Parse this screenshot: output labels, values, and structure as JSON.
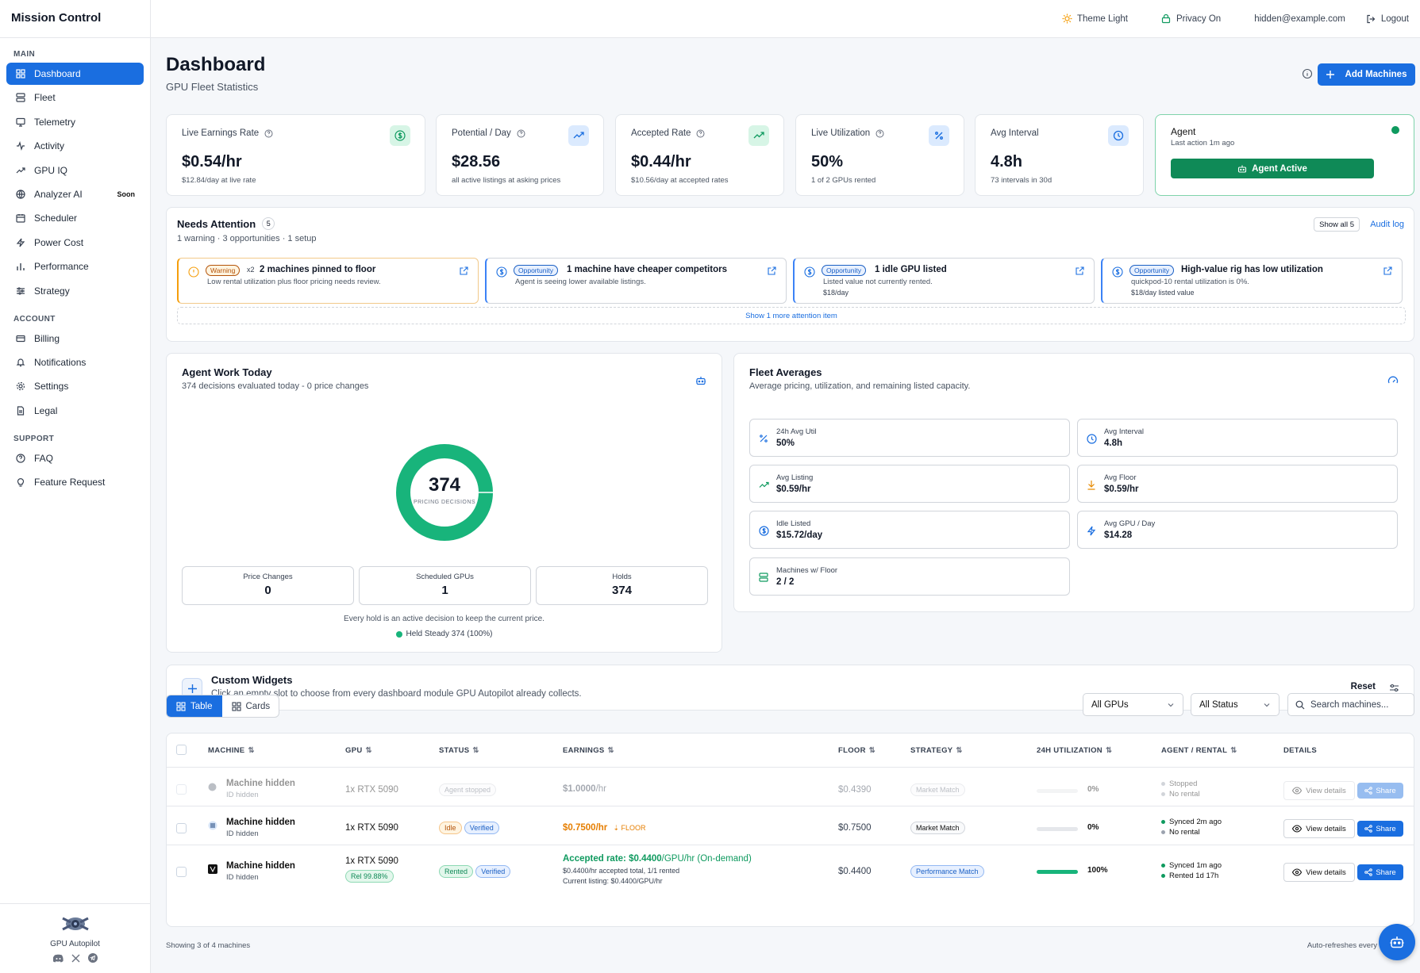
{
  "app": {
    "title": "Mission Control"
  },
  "sidebar": {
    "sections": [
      {
        "label": "MAIN",
        "items": [
          {
            "label": "Dashboard",
            "icon": "grid-icon",
            "active": true
          },
          {
            "label": "Fleet",
            "icon": "server-icon"
          },
          {
            "label": "Telemetry",
            "icon": "monitor-icon"
          },
          {
            "label": "Activity",
            "icon": "activity-icon"
          },
          {
            "label": "GPU IQ",
            "icon": "trending-up-icon"
          },
          {
            "label": "Analyzer AI",
            "icon": "globe-icon",
            "badge": "Soon"
          },
          {
            "label": "Scheduler",
            "icon": "calendar-icon"
          },
          {
            "label": "Power Cost",
            "icon": "zap-icon"
          },
          {
            "label": "Performance",
            "icon": "bar-chart-icon"
          },
          {
            "label": "Strategy",
            "icon": "sliders-icon"
          }
        ]
      },
      {
        "label": "ACCOUNT",
        "items": [
          {
            "label": "Billing",
            "icon": "credit-card-icon"
          },
          {
            "label": "Notifications",
            "icon": "bell-icon"
          },
          {
            "label": "Settings",
            "icon": "gear-icon"
          },
          {
            "label": "Legal",
            "icon": "file-text-icon"
          }
        ]
      },
      {
        "label": "SUPPORT",
        "items": [
          {
            "label": "FAQ",
            "icon": "help-circle-icon"
          },
          {
            "label": "Feature Request",
            "icon": "lightbulb-icon"
          }
        ]
      }
    ],
    "footer": {
      "name": "GPU Autopilot",
      "socials": [
        "discord-icon",
        "x-icon",
        "telegram-icon"
      ]
    }
  },
  "topbar": {
    "theme": "Theme Light",
    "privacy": "Privacy On",
    "email": "hidden@example.com",
    "logout": "Logout"
  },
  "header": {
    "title": "Dashboard",
    "subtitle": "GPU Fleet Statistics",
    "add_label": "Add Machines"
  },
  "stats": [
    {
      "label": "Live Earnings Rate",
      "value": "$0.54/hr",
      "sub": "$12.84/day at live rate",
      "icon": "dollar-icon",
      "tone": "green"
    },
    {
      "label": "Potential / Day",
      "value": "$28.56",
      "sub": "all active listings at asking prices",
      "icon": "trending-up-icon",
      "tone": "blue"
    },
    {
      "label": "Accepted Rate",
      "value": "$0.44/hr",
      "sub": "$10.56/day at accepted rates",
      "icon": "trending-up-icon",
      "tone": "green"
    },
    {
      "label": "Live Utilization",
      "value": "50%",
      "sub": "1 of 2 GPUs rented",
      "icon": "percent-icon",
      "tone": "blue"
    },
    {
      "label": "Avg Interval",
      "value": "4.8h",
      "sub": "73 intervals in 30d",
      "icon": "clock-icon",
      "tone": "blue"
    }
  ],
  "agent": {
    "title": "Agent",
    "sub": "Last action 1m ago",
    "button": "Agent Active"
  },
  "attention": {
    "title": "Needs Attention",
    "count": "5",
    "sub": "1 warning · 3 opportunities · 1 setup",
    "show_all": "Show all 5",
    "audit": "Audit log",
    "items": [
      {
        "pill": "Warning",
        "mult": "x2",
        "title": "2 machines pinned to floor",
        "desc": "Low rental utilization plus floor pricing needs review.",
        "extra": ""
      },
      {
        "pill": "Opportunity",
        "title": "1 machine have cheaper competitors",
        "desc": "Agent is seeing lower available listings.",
        "extra": ""
      },
      {
        "pill": "Opportunity",
        "title": "1 idle GPU listed",
        "desc": "Listed value not currently rented.",
        "extra": "$18/day"
      },
      {
        "pill": "Opportunity",
        "title": "High-value rig has low utilization",
        "desc": "quickpod-10 rental utilization is 0%.",
        "extra": "$18/day listed value"
      }
    ],
    "show_more": "Show 1 more attention item"
  },
  "agent_work": {
    "title": "Agent Work Today",
    "sub": "374 decisions evaluated today - 0 price changes",
    "total": "374",
    "total_label": "PRICING DECISIONS",
    "held_fraction": 1.0,
    "minis": [
      {
        "label": "Price Changes",
        "value": "0"
      },
      {
        "label": "Scheduled GPUs",
        "value": "1"
      },
      {
        "label": "Holds",
        "value": "374"
      }
    ],
    "note": "Every hold is an active decision to keep the current price.",
    "legend": "Held Steady 374 (100%)",
    "color": "#18b47b"
  },
  "fleet_avg": {
    "title": "Fleet Averages",
    "sub": "Average pricing, utilization, and remaining listed capacity.",
    "tiles": [
      {
        "label": "24h Avg Util",
        "value": "50%",
        "icon": "percent-icon"
      },
      {
        "label": "Avg Interval",
        "value": "4.8h",
        "icon": "clock-icon"
      },
      {
        "label": "Avg Listing",
        "value": "$0.59/hr",
        "icon": "trending-up-icon"
      },
      {
        "label": "Avg Floor",
        "value": "$0.59/hr",
        "icon": "arrow-down-icon"
      },
      {
        "label": "Idle Listed",
        "value": "$15.72/day",
        "icon": "dollar-icon"
      },
      {
        "label": "Avg GPU / Day",
        "value": "$14.28",
        "icon": "zap-icon"
      },
      {
        "label": "Machines w/ Floor",
        "value": "2 / 2",
        "icon": "server-icon"
      }
    ]
  },
  "widgets": {
    "title": "Custom Widgets",
    "sub": "Click an empty slot to choose from every dashboard module GPU Autopilot already collects.",
    "reset": "Reset"
  },
  "table_controls": {
    "table": "Table",
    "cards": "Cards",
    "gpu_filter": "All GPUs",
    "status_filter": "All Status",
    "search_placeholder": "Search machines..."
  },
  "table": {
    "headers": [
      "MACHINE",
      "GPU",
      "STATUS",
      "EARNINGS",
      "FLOOR",
      "STRATEGY",
      "24H UTILIZATION",
      "AGENT / RENTAL",
      "DETAILS"
    ],
    "rows": [
      {
        "name": "Machine hidden",
        "id": "ID hidden",
        "gpu": "1x RTX 5090",
        "rel": "",
        "status": [
          "Agent stopped"
        ],
        "earn_main": "$1.0000",
        "earn_unit": "/hr",
        "earn_flag": "",
        "earn_lines": [],
        "floor": "$0.4390",
        "strategy": "Market Match",
        "util": 0,
        "util_label": "0%",
        "agent": [
          "Stopped",
          "No rental"
        ],
        "view": "View details",
        "share": "Share"
      },
      {
        "name": "Machine hidden",
        "id": "ID hidden",
        "gpu": "1x RTX 5090",
        "rel": "",
        "status": [
          "Idle",
          "Verified"
        ],
        "earn_main": "$0.7500/hr",
        "earn_unit": "",
        "earn_flag": "FLOOR",
        "earn_lines": [],
        "floor": "$0.7500",
        "strategy": "Market Match",
        "util": 0,
        "util_label": "0%",
        "agent": [
          "Synced 2m ago",
          "No rental"
        ],
        "view": "View details",
        "share": "Share"
      },
      {
        "name": "Machine hidden",
        "id": "ID hidden",
        "gpu": "1x RTX 5090",
        "rel": "Rel 99.88%",
        "status": [
          "Rented",
          "Verified"
        ],
        "earn_main": "Accepted rate: $0.4400",
        "earn_unit": "/GPU/hr (On-demand)",
        "earn_flag": "",
        "earn_lines": [
          "$0.4400/hr accepted total, 1/1 rented",
          "Current listing: $0.4400/GPU/hr"
        ],
        "floor": "$0.4400",
        "strategy": "Performance Match",
        "util": 1.0,
        "util_label": "100%",
        "agent": [
          "Synced 1m ago",
          "Rented 1d 17h"
        ],
        "view": "View details",
        "share": "Share"
      }
    ],
    "footer_left": "Showing 3 of 4 machines",
    "footer_right": "Auto-refreshes every"
  }
}
